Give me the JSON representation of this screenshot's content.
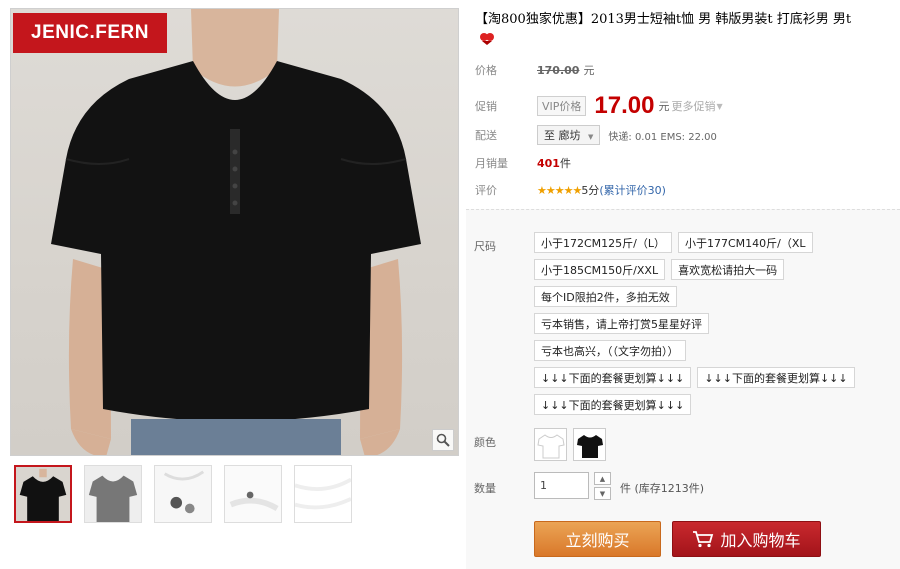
{
  "gallery": {
    "brand": "JENIC.FERN",
    "thumbnails": [
      "black-tee-front",
      "gray-tee-front",
      "button-detail",
      "collar-detail",
      "white-fabric"
    ]
  },
  "product": {
    "title": "【淘800独家优惠】2013男士短袖t恤 男 韩版男装t 打底衫男 男t"
  },
  "price": {
    "label": "价格",
    "original": "170.00",
    "unit": "元"
  },
  "promo": {
    "label": "促销",
    "tag": "VIP价格",
    "price": "17.00",
    "unit": "元",
    "more": "更多促销"
  },
  "shipping": {
    "label": "配送",
    "destination": "至 廊坊",
    "fees": "快递: 0.01 EMS: 22.00"
  },
  "sales": {
    "label": "月销量",
    "count": "401",
    "unit": "件"
  },
  "rating": {
    "label": "评价",
    "stars": "★★★★★",
    "score": "5分",
    "reviews": "(累计评价30)"
  },
  "options": {
    "size_label": "尺码",
    "size_rows": [
      [
        "小于172CM125斤/（L）",
        "小于177CM140斤/（XL"
      ],
      [
        "小于185CM150斤/XXL",
        "喜欢宽松请拍大一码"
      ],
      [
        "每个ID限拍2件，多拍无效"
      ],
      [
        "亏本销售，请上帝打赏5星星好评"
      ],
      [
        "亏本也高兴，（（文字勿拍））"
      ],
      [
        "↓↓↓下面的套餐更划算↓↓↓",
        "↓↓↓下面的套餐更划算↓↓↓"
      ],
      [
        "↓↓↓下面的套餐更划算↓↓↓"
      ]
    ],
    "color_label": "颜色",
    "colors": [
      "white",
      "black"
    ],
    "qty_label": "数量",
    "qty_value": "1",
    "stock": "件 (库存1213件)"
  },
  "actions": {
    "buy_now": "立刻购买",
    "add_cart": "加入购物车"
  },
  "colors": {
    "price_red": "#c40000",
    "brand_red": "#c4161c",
    "buy_orange": "#d9782a",
    "cart_red": "#a3141a",
    "link_blue": "#3366aa"
  }
}
